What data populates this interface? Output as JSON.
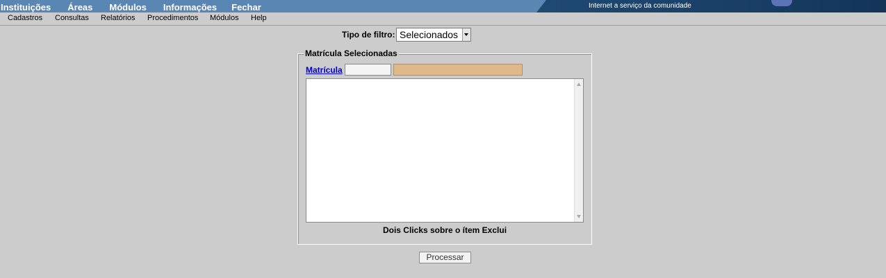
{
  "top_nav": {
    "items": [
      "Instituições",
      "Áreas",
      "Módulos",
      "Informações",
      "Fechar"
    ]
  },
  "banner": {
    "tagline": "Internet a serviço da comunidade"
  },
  "menu": {
    "items": [
      "Cadastros",
      "Consultas",
      "Relatórios",
      "Procedimentos",
      "Módulos",
      "Help"
    ]
  },
  "filter": {
    "label": "Tipo de filtro:",
    "selected": "Selecionados"
  },
  "panel": {
    "legend": "Matrícula Selecionadas",
    "matricula_link": "Matrícula",
    "matricula_value": "",
    "name_value": "",
    "hint": "Dois Clicks sobre o ítem Exclui"
  },
  "actions": {
    "process_label": "Processar"
  },
  "colors": {
    "header_bg": "#5a86b4",
    "banner_bg": "#1a3f66",
    "page_bg": "#cccccc",
    "name_field_bg": "#e0b98a",
    "link": "#0000cc"
  }
}
